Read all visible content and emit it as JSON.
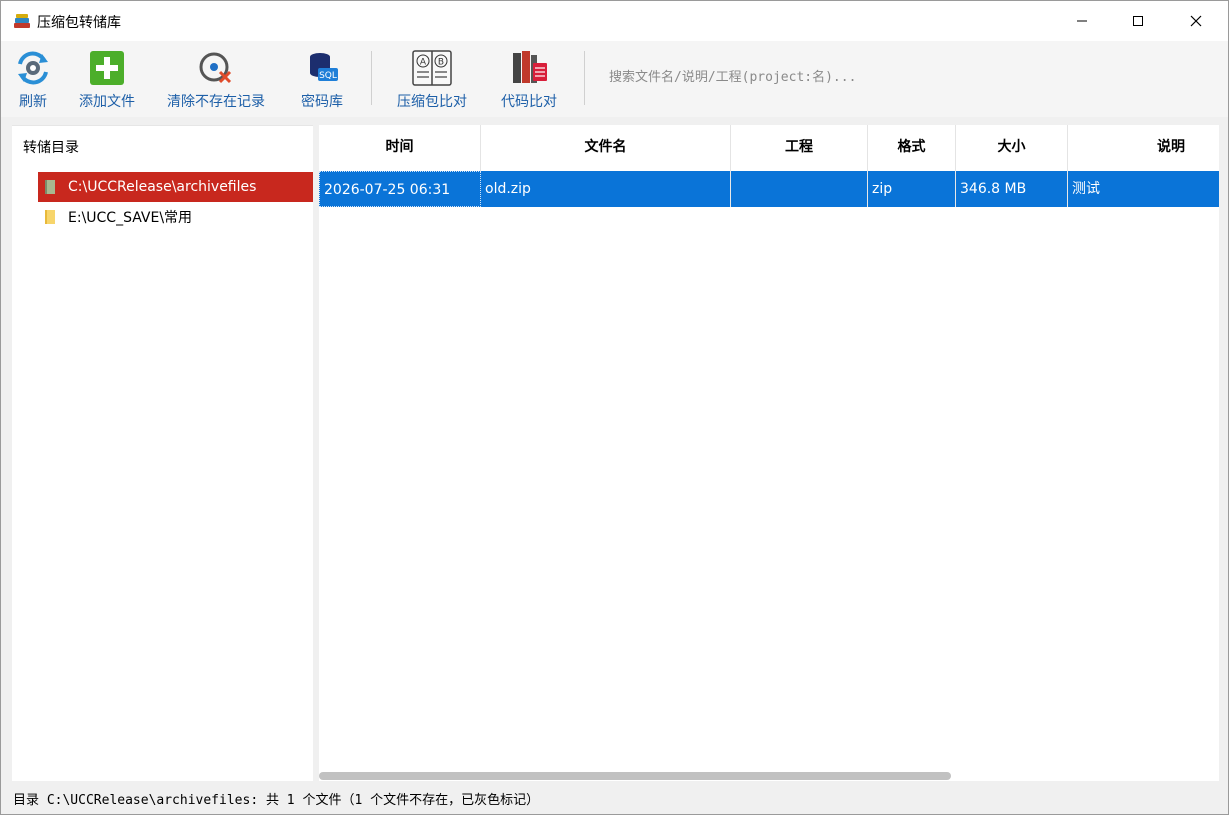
{
  "window": {
    "title": "压缩包转储库",
    "icon": "books-icon"
  },
  "toolbar": {
    "buttons": [
      {
        "label": "刷新",
        "icon": "refresh-gear-icon"
      },
      {
        "label": "添加文件",
        "icon": "green-plus-icon"
      },
      {
        "label": "清除不存在记录",
        "icon": "clear-record-icon"
      },
      {
        "label": "密码库",
        "icon": "sql-database-icon"
      },
      {
        "label": "压缩包比对",
        "icon": "ab-compare-icon"
      },
      {
        "label": "代码比对",
        "icon": "code-compare-icon"
      }
    ],
    "search_placeholder": "搜索文件名/说明/工程(project:名)..."
  },
  "tree": {
    "header": "转储目录",
    "items": [
      {
        "label": "C:\\UCCRelease\\archivefiles",
        "selected": true
      },
      {
        "label": "E:\\UCC_SAVE\\常用",
        "selected": false
      }
    ]
  },
  "table": {
    "columns": [
      "时间",
      "文件名",
      "工程",
      "格式",
      "大小",
      "说明"
    ],
    "rows": [
      {
        "time": "2026-07-25 06:31",
        "filename": "old.zip",
        "project": "",
        "format": "zip",
        "size": "346.8 MB",
        "note": "测试",
        "selected": true
      }
    ]
  },
  "status": {
    "text": "目录 C:\\UCCRelease\\archivefiles: 共 1 个文件（1 个文件不存在，已灰色标记）"
  },
  "colors": {
    "selection_blue": "#0a74d8",
    "tree_selected_red": "#c8281e",
    "toolbar_label": "#1d5fa8"
  }
}
